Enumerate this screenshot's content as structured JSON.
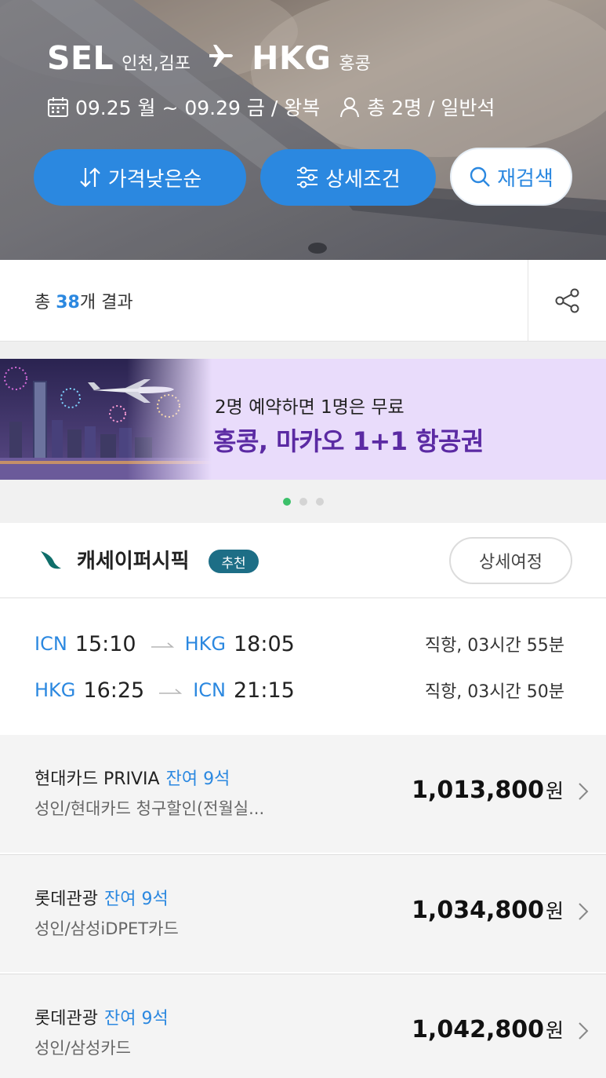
{
  "header": {
    "origin_code": "SEL",
    "origin_city": "인천,김포",
    "destination_code": "HKG",
    "destination_city": "홍콩",
    "plane_icon": "airplane-icon",
    "date_range": "09.25 월 ~ 09.29 금 / 왕복",
    "passengers": "총 2명 / 일반석",
    "buttons": {
      "sort": "가격낮은순",
      "filter": "상세조건",
      "research": "재검색"
    }
  },
  "results": {
    "prefix": "총 ",
    "count": "38",
    "suffix": "개 결과",
    "share_icon": "share-icon"
  },
  "banner": {
    "subtitle": "2명 예약하면 1명은 무료",
    "title": "홍콩, 마카오 1+1 항공권",
    "slide_count": 3,
    "active_slide": 1
  },
  "airline": {
    "name": "캐세이퍼시픽",
    "badge": "추천",
    "detail_button": "상세여정"
  },
  "legs": [
    {
      "dep_airport": "ICN",
      "dep_time": "15:10",
      "arr_airport": "HKG",
      "arr_time": "18:05",
      "duration": "직항, 03시간 55분"
    },
    {
      "dep_airport": "HKG",
      "dep_time": "16:25",
      "arr_airport": "ICN",
      "arr_time": "21:15",
      "duration": "직항, 03시간 50분"
    }
  ],
  "fares": [
    {
      "seller": "현대카드 PRIVIA",
      "seats": "잔여 9석",
      "condition": "성인/현대카드 청구할인(전월실...",
      "price": "1,013,800",
      "currency": "원"
    },
    {
      "seller": "롯데관광",
      "seats": "잔여 9석",
      "condition": "성인/삼성iDPET카드",
      "price": "1,034,800",
      "currency": "원"
    },
    {
      "seller": "롯데관광",
      "seats": "잔여 9석",
      "condition": "성인/삼성카드",
      "price": "1,042,800",
      "currency": "원"
    }
  ],
  "colors": {
    "accent": "#2b88e0",
    "badge": "#1d6e86",
    "banner_bg": "#e9dcfb",
    "banner_title": "#5b2aa3",
    "dot_active": "#3cc06a"
  }
}
